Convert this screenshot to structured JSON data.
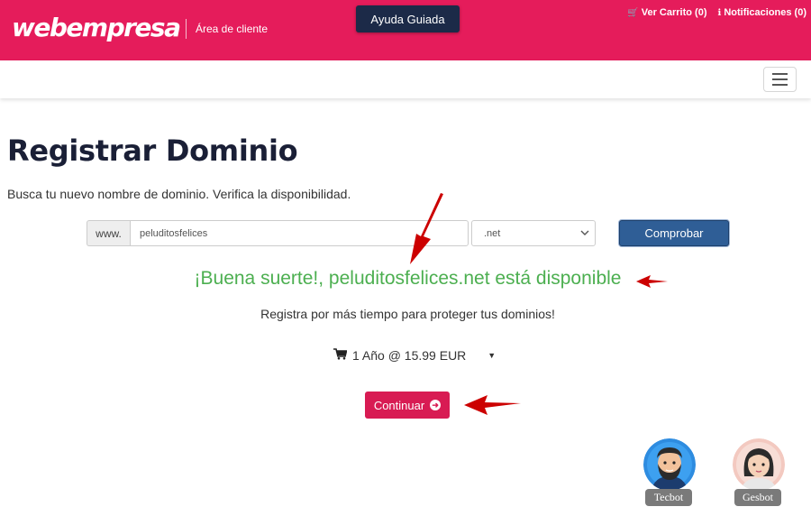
{
  "header": {
    "logo_text": "webempresa",
    "area_label": "Área de cliente",
    "guide_button": "Ayuda Guiada",
    "cart_link": "Ver Carrito (0)",
    "notifications_link": "Notificaciones (0)",
    "brand_color": "#e51c5b"
  },
  "main": {
    "title": "Registrar Dominio",
    "subtitle": "Busca tu nuevo nombre de dominio. Verifica la disponibilidad.",
    "search": {
      "prefix": "www.",
      "value": "peluditosfelices",
      "tld": ".net",
      "button": "Comprobar"
    },
    "availability_message": "¡Buena suerte!, peluditosfelices.net está disponible",
    "availability_color": "#4caf50",
    "promo_text": "Registra por más tiempo para proteger tus dominios!",
    "period_selected": "1 Año @ 15.99 EUR",
    "continue_button": "Continuar"
  },
  "bots": [
    {
      "name": "Tecbot",
      "icon": "bearded-man-avatar-icon"
    },
    {
      "name": "Gesbot",
      "icon": "woman-avatar-icon"
    }
  ],
  "annotation_color": "#cc0000"
}
